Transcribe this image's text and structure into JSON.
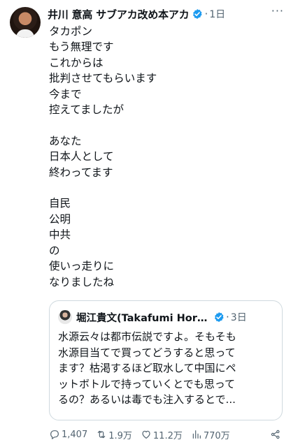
{
  "post": {
    "author_name": "井川 意高 サブアカ改め本アカ",
    "time": "1日",
    "more_label": "···",
    "body": "タカポン\nもう無理です\nこれからは\n批判させてもらいます\n今まで\n控えてましたが\n\nあなた\n日本人として\n終わってます\n\n自民\n公明\n中共\nの\n使いっ走りに\nなりましたね"
  },
  "quote": {
    "author_name": "堀江貴文(Takafumi Hori...",
    "time": "3日",
    "body": "水源云々は都市伝説ですよ。そもそも\n水源目当てで買ってどうすると思って\nます？枯渇するほど取水して中国にペ\nットボトルで持っていくとでも思って\nるの？あるいは毒でも注入するとで..."
  },
  "actions": {
    "replies": "1,407",
    "reposts": "1.9万",
    "likes": "11.2万",
    "views": "770万"
  },
  "colors": {
    "verified": "#1d9bf0",
    "muted": "#536471"
  },
  "icons": [
    "verified-badge-icon",
    "reply-icon",
    "repost-icon",
    "like-icon",
    "views-icon",
    "share-icon"
  ]
}
